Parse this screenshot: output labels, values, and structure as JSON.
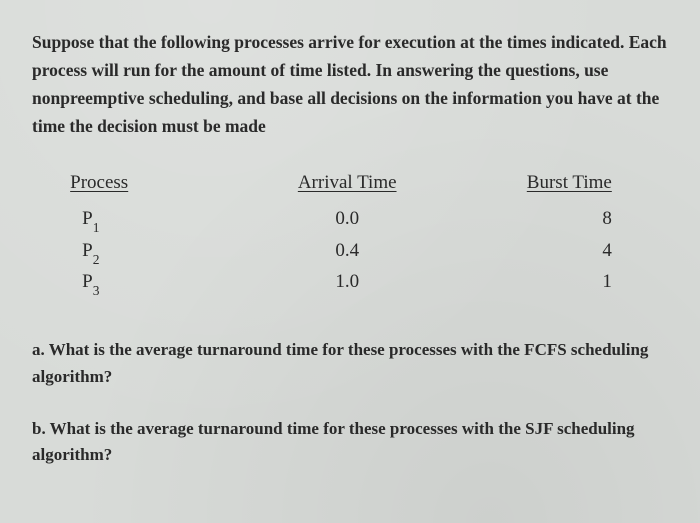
{
  "intro": "Suppose that the following processes arrive for execution at the times indicated. Each process will run for the amount of time listed. In answering the questions, use nonpreemptive scheduling, and base all decisions on the information you have at the time the decision must be made",
  "table": {
    "headers": {
      "process": "Process",
      "arrival": "Arrival Time",
      "burst": "Burst Time"
    },
    "rows": [
      {
        "process_base": "P",
        "process_sub": "1",
        "arrival": "0.0",
        "burst": "8"
      },
      {
        "process_base": "P",
        "process_sub": "2",
        "arrival": "0.4",
        "burst": "4"
      },
      {
        "process_base": "P",
        "process_sub": "3",
        "arrival": "1.0",
        "burst": "1"
      }
    ]
  },
  "questions": {
    "a": "a. What is the average turnaround time for these processes with the FCFS scheduling algorithm?",
    "b": "b. What is the average turnaround time for these processes with the SJF scheduling algorithm?"
  }
}
